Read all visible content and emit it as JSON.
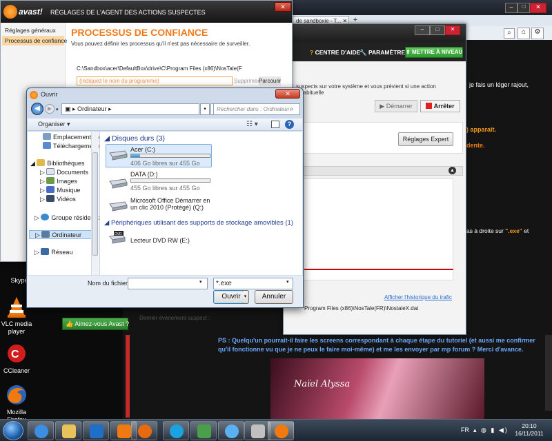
{
  "desktop": {
    "icons": [
      {
        "label": "Skype",
        "icon": "skype-icon"
      },
      {
        "label": "VLC media player",
        "icon": "vlc-icon"
      },
      {
        "label": "CCleaner",
        "icon": "ccleaner-icon"
      },
      {
        "label": "Mozilla Firefox",
        "icon": "firefox-icon"
      }
    ]
  },
  "browser": {
    "tab_label": "de sandboxie - T...",
    "texts": {
      "fais": "je fais un léger rajout,",
      "apparait": ") apparaît.",
      "dente": "dente.",
      "droite_pre": "as à droite sur ",
      "droite_exe": "\".exe\"",
      "droite_post": " et",
      "ps": "PS : Quelqu'un pourrait-il faire les screens correspondant à chaque étape du tutoriel (et aussi me confirmer qu'il fonctionne vu que je ne peux le faire moi-même) et me les envoyer par mp forum ? Merci d'avance."
    },
    "banner_text": "Naïel Alyssa"
  },
  "avast_main": {
    "help_label": "CENTRE D'AIDE",
    "settings_label": "PARAMÈTRES",
    "upgrade_label": "METTRE À NIVEAU",
    "desc_text": "suspects sur votre système et vous prévient si une action inhabituelle",
    "start_label": "Démarrer",
    "stop_label": "Arrêter",
    "expert_label": "Réglages Expert",
    "history_link": "Afficher l'historique du trafic",
    "path_text": "Program Files (x86)\\NosTale(FR)\\NostaleX.dat",
    "last_event_label": "Dernier événement suspect :",
    "like_label": "Aimez-vous Avast ?"
  },
  "avast_settings": {
    "logo_text": "avast!",
    "title": "RÉGLAGES DE L'AGENT DES ACTIONS SUSPECTES",
    "nav": [
      "Réglages généraux",
      "Processus de confiance"
    ],
    "heading": "PROCESSUS DE CONFIANCE",
    "description": "Vous pouvez définir les processus qu'il n'est pas nécessaire de surveiller.",
    "path_entry": "C:\\Sandbox\\acer\\DefaultBox\\drive\\C\\Program Files (x86)\\NosTale(F",
    "input_placeholder": "(indiquez le nom du programme)",
    "delete_label": "Supprimer",
    "browse_label": "Parcourir"
  },
  "open_dialog": {
    "title": "Ouvrir",
    "breadcrumb": "Ordinateur",
    "search_placeholder": "Rechercher dans : Ordinateur",
    "organize_label": "Organiser",
    "tree": [
      {
        "label": "Emplacements ré",
        "icon": "recent-places-icon",
        "indent": 1
      },
      {
        "label": "Téléchargements",
        "icon": "downloads-icon",
        "indent": 1
      },
      {
        "label": "Bibliothèques",
        "icon": "libraries-icon",
        "indent": 0
      },
      {
        "label": "Documents",
        "icon": "documents-icon",
        "indent": 1
      },
      {
        "label": "Images",
        "icon": "images-icon",
        "indent": 1
      },
      {
        "label": "Musique",
        "icon": "music-icon",
        "indent": 1
      },
      {
        "label": "Vidéos",
        "icon": "videos-icon",
        "indent": 1
      },
      {
        "label": "Groupe résidentiel",
        "icon": "homegroup-icon",
        "indent": 0
      },
      {
        "label": "Ordinateur",
        "icon": "computer-icon",
        "indent": 0
      },
      {
        "label": "Réseau",
        "icon": "network-icon",
        "indent": 0
      }
    ],
    "hard_disks_header": "Disques durs (3)",
    "drives": [
      {
        "name": "Acer (C:)",
        "free": "406 Go libres sur 455 Go",
        "used_fraction": 0.11
      },
      {
        "name": "DATA (D:)",
        "free": "455 Go libres sur 455 Go",
        "used_fraction": 0.0
      },
      {
        "name": "Microsoft Office Démarrer en un clic 2010 (Protégé) (Q:)",
        "free": "",
        "used_fraction": null
      }
    ],
    "removable_header": "Périphériques utilisant des supports de stockage amovibles (1)",
    "dvd_label": "Lecteur DVD RW (E:)",
    "filename_label": "Nom du fichier :",
    "filter_value": "*.exe",
    "open_label": "Ouvrir",
    "cancel_label": "Annuler"
  },
  "taskbar": {
    "apps": [
      "windows-start-icon",
      "ie-icon",
      "explorer-icon",
      "media-player-icon",
      "firefox-icon",
      "vlc-icon",
      "skype-icon",
      "network-app-icon",
      "itunes-icon",
      "paint-icon",
      "avast-icon"
    ],
    "language": "FR",
    "time": "20:10",
    "date": "16/11/2011"
  }
}
